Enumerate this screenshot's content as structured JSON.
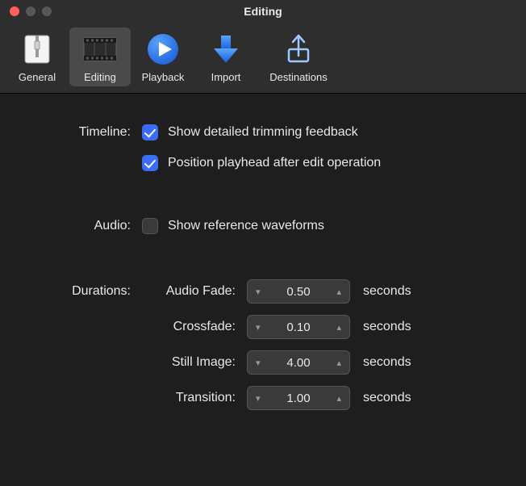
{
  "window": {
    "title": "Editing"
  },
  "toolbar": {
    "items": [
      {
        "label": "General"
      },
      {
        "label": "Editing"
      },
      {
        "label": "Playback"
      },
      {
        "label": "Import"
      },
      {
        "label": "Destinations"
      }
    ]
  },
  "timeline": {
    "section_label": "Timeline:",
    "opt1_label": "Show detailed trimming feedback",
    "opt2_label": "Position playhead after edit operation"
  },
  "audio": {
    "section_label": "Audio:",
    "opt1_label": "Show reference waveforms"
  },
  "durations": {
    "section_label": "Durations:",
    "unit": "seconds",
    "items": [
      {
        "name": "Audio Fade:",
        "value": "0.50"
      },
      {
        "name": "Crossfade:",
        "value": "0.10"
      },
      {
        "name": "Still Image:",
        "value": "4.00"
      },
      {
        "name": "Transition:",
        "value": "1.00"
      }
    ]
  }
}
